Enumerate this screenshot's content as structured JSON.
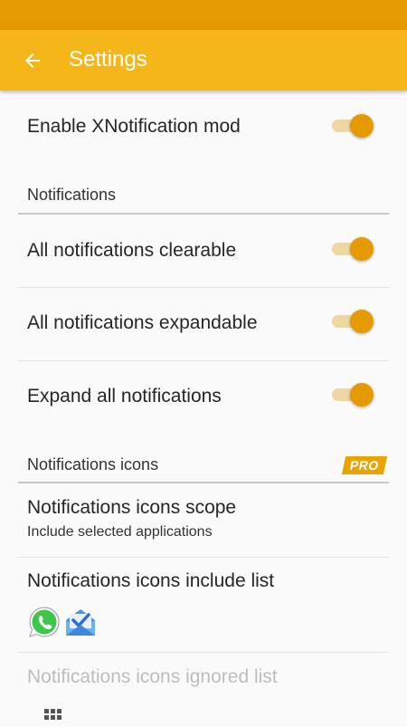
{
  "header": {
    "title": "Settings",
    "back_icon": "arrow-left-icon"
  },
  "colors": {
    "status_bar": "#e49a00",
    "app_bar": "#f4b619",
    "accent": "#e49a00",
    "switch_track": "#efd6a2"
  },
  "settings": {
    "enable_mod": {
      "label": "Enable XNotification mod",
      "on": true
    },
    "notifications_section": "Notifications",
    "clearable": {
      "label": "All notifications clearable",
      "on": true
    },
    "expandable": {
      "label": "All notifications expandable",
      "on": true
    },
    "expand_all": {
      "label": "Expand all notifications",
      "on": true
    },
    "icons_section": "Notifications icons",
    "pro_badge": "PRO",
    "icons_scope": {
      "label": "Notifications icons scope",
      "summary": "Include selected applications"
    },
    "include_list": {
      "label": "Notifications icons include list",
      "apps": [
        "whatsapp-icon",
        "inbox-icon"
      ]
    },
    "ignored_list": {
      "label": "Notifications icons ignored list",
      "icon": "apps-grid-icon"
    }
  }
}
